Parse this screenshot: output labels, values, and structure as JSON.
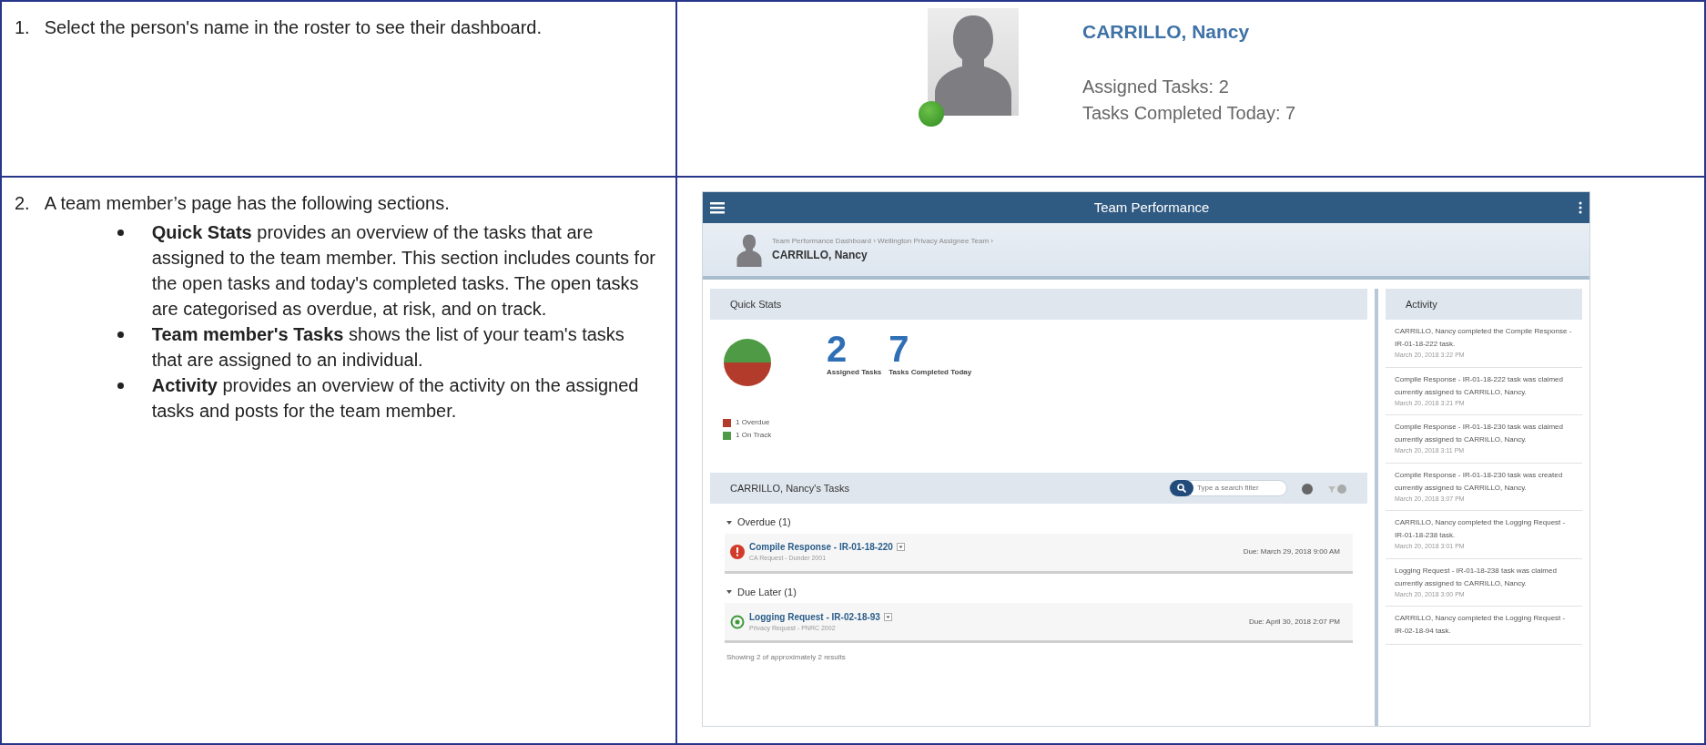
{
  "rows": [
    {
      "number": "1.",
      "intro": "Select the person's name in the roster to see their dashboard.",
      "bullets": []
    },
    {
      "number": "2.",
      "intro": "A team member’s page has the following sections.",
      "bullets": [
        "**Quick Stats** provides an overview of the tasks that are assigned to the team member. This section includes counts for the open tasks and today's completed tasks. The open tasks are categorised as overdue, at risk, and on track.",
        "**Team member's Tasks** shows the list of your team's tasks that are assigned to an individual.",
        "**Activity** provides an overview of the activity on the assigned tasks and posts for the team member."
      ]
    }
  ],
  "roster_card": {
    "name": "CARRILLO, Nancy",
    "stats": [
      {
        "label": "Assigned Tasks:",
        "value": "2"
      },
      {
        "label": "Tasks Completed Today:",
        "value": "7"
      }
    ]
  },
  "app": {
    "title": "Team Performance",
    "breadcrumb": "Team Performance Dashboard › Wellington Privacy Assignee Team ›",
    "member": "CARRILLO, Nancy",
    "quick_stats": {
      "title": "Quick Stats",
      "counts": [
        {
          "value": "2",
          "label": "Assigned Tasks"
        },
        {
          "value": "7",
          "label": "Tasks Completed Today"
        }
      ],
      "legend": [
        {
          "label": "1 Overdue",
          "color": "#b23b2c"
        },
        {
          "label": "1 On Track",
          "color": "#4f9a45"
        }
      ]
    },
    "tasks": {
      "title": "CARRILLO, Nancy's Tasks",
      "search_placeholder": "Type a search filter",
      "groups": [
        {
          "label": "Overdue (1)",
          "expanded": true,
          "items": [
            {
              "kind": "overdue",
              "title": "Compile Response - IR-01-18-220",
              "subtitle": "CA Request - Dunder 2001",
              "due": "Due: March 29, 2018 9:00 AM"
            }
          ]
        },
        {
          "label": "Due Later (1)",
          "expanded": true,
          "items": [
            {
              "kind": "on_track",
              "title": "Logging Request - IR-02-18-93",
              "subtitle": "Privacy Request - PNRC 2002",
              "due": "Due: April 30, 2018 2:07 PM"
            }
          ]
        }
      ],
      "footer": "Showing 2 of approximately 2 results"
    },
    "activity": {
      "title": "Activity",
      "items": [
        {
          "text": "CARRILLO, Nancy completed the Compile Response - IR-01-18-222 task.",
          "time": "March 20, 2018 3:22 PM"
        },
        {
          "text": "Compile Response - IR-01-18-222 task was claimed currently assigned to CARRILLO, Nancy.",
          "time": "March 20, 2018 3:21 PM"
        },
        {
          "text": "Compile Response - IR-01-18-230 task was claimed currently assigned to CARRILLO, Nancy.",
          "time": "March 20, 2018 3:11 PM"
        },
        {
          "text": "Compile Response - IR-01-18-230 task was created currently assigned to CARRILLO, Nancy.",
          "time": "March 20, 2018 3:07 PM"
        },
        {
          "text": "CARRILLO, Nancy completed the Logging Request - IR-01-18-238 task.",
          "time": "March 20, 2018 3:01 PM"
        },
        {
          "text": "Logging Request - IR-01-18-238 task was claimed currently assigned to CARRILLO, Nancy.",
          "time": "March 20, 2018 3:00 PM"
        },
        {
          "text": "CARRILLO, Nancy completed the Logging Request - IR-02-18-94 task."
        }
      ]
    }
  }
}
